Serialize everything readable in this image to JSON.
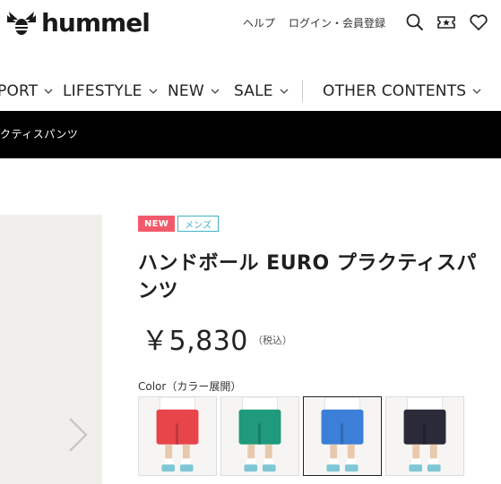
{
  "header": {
    "logo_text": "hummel",
    "help_label": "ヘルプ",
    "login_label": "ログイン・会員登録"
  },
  "icons": {
    "logo": "hummel-bee-icon",
    "search": "search-icon",
    "coupon": "ticket-star-icon",
    "favorite": "heart-icon"
  },
  "nav": {
    "items": [
      {
        "label": "PORT"
      },
      {
        "label": "LIFESTYLE"
      },
      {
        "label": "NEW"
      },
      {
        "label": "SALE"
      },
      {
        "label": "OTHER CONTENTS"
      }
    ]
  },
  "breadcrumb": {
    "text": "クティスパンツ"
  },
  "product": {
    "badge_new": "NEW",
    "badge_category": "メンズ",
    "title": "ハンドボール EURO プラクティスパンツ",
    "price": "￥5,830",
    "tax_note": "（税込）",
    "color_label": "Color（カラー展開）",
    "swatches": [
      {
        "name": "red",
        "color": "#e8454a",
        "selected": false
      },
      {
        "name": "green",
        "color": "#1f9a7c",
        "selected": false
      },
      {
        "name": "blue",
        "color": "#3b7fd8",
        "selected": true
      },
      {
        "name": "dark",
        "color": "#2a2a38",
        "selected": false
      }
    ]
  },
  "colors": {
    "badge_new": "#f25a6b",
    "badge_category": "#3fb3c6",
    "crumb_bar": "#000000"
  }
}
